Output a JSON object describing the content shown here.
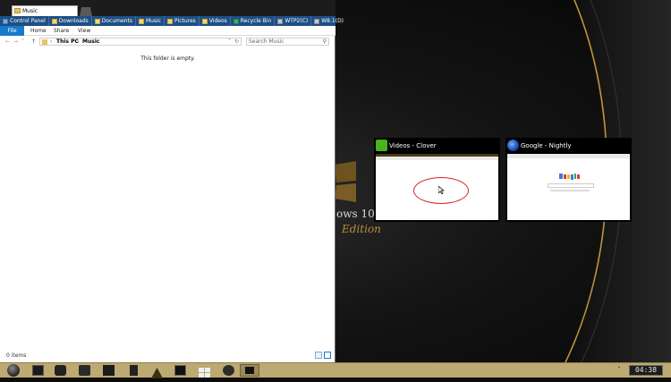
{
  "explorer": {
    "tab_title": "Music",
    "favorites": [
      {
        "label": "Control Panel",
        "icon": "control-panel-icon",
        "color": "blue"
      },
      {
        "label": "Downloads",
        "icon": "folder-icon",
        "color": "yellow"
      },
      {
        "label": "Documents",
        "icon": "folder-icon",
        "color": "yellow"
      },
      {
        "label": "Music",
        "icon": "folder-icon",
        "color": "yellow"
      },
      {
        "label": "Pictures",
        "icon": "folder-icon",
        "color": "yellow"
      },
      {
        "label": "Videos",
        "icon": "folder-icon",
        "color": "yellow"
      },
      {
        "label": "Recycle Bin",
        "icon": "recycle-bin-icon",
        "color": "green"
      },
      {
        "label": "WTP2(C)",
        "icon": "drive-icon",
        "color": "grey"
      },
      {
        "label": "W8.1(D)",
        "icon": "drive-icon",
        "color": "grey"
      }
    ],
    "ribbon_tabs": [
      "File",
      "Home",
      "Share",
      "View"
    ],
    "breadcrumb": [
      "This PC",
      "Music"
    ],
    "search_placeholder": "Search Music",
    "empty_message": "This folder is empty.",
    "status": "0 items"
  },
  "switcher": {
    "items": [
      {
        "title": "Videos - Clover",
        "icon": "clover-icon"
      },
      {
        "title": "Google - Nightly",
        "icon": "firefox-nightly-icon"
      }
    ]
  },
  "desktop": {
    "watermark_text": "ows 10",
    "watermark_subtext": "Edition"
  },
  "taskbar": {
    "clock": "04:38",
    "icons": [
      "start-orb-icon",
      "monitor-icon",
      "clover-icon",
      "printer-icon",
      "calculator-icon",
      "phone-icon",
      "warning-icon",
      "terminal-icon",
      "windows-icon",
      "gear-icon",
      "active-window-icon"
    ]
  },
  "colors": {
    "ribbon_file": "#1979ca",
    "favorites_bar": "#1e4f86",
    "taskbar": "#bda972",
    "gold": "#b98f3d"
  }
}
